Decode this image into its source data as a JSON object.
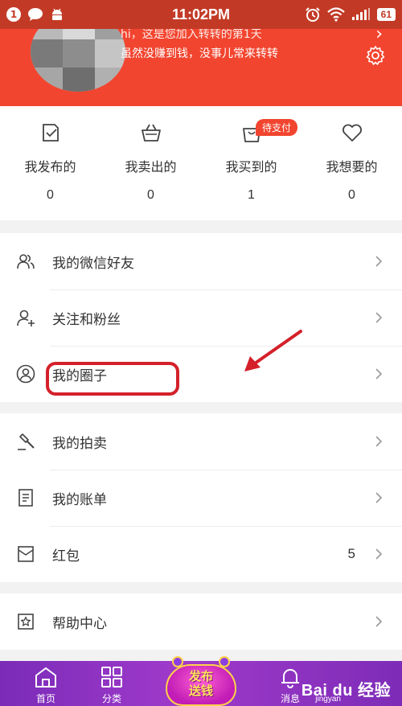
{
  "status_bar": {
    "notification_count": "1",
    "time": "11:02PM",
    "battery": "61"
  },
  "profile": {
    "message_line1": "hi，这是您加入转转的第1天",
    "message_line2": "虽然没赚到钱，没事儿常来转转"
  },
  "orders": [
    {
      "label": "我发布的",
      "count": "0",
      "icon": "check-box-icon"
    },
    {
      "label": "我卖出的",
      "count": "0",
      "icon": "basket-icon"
    },
    {
      "label": "我买到的",
      "count": "1",
      "icon": "bag-icon",
      "badge": "待支付"
    },
    {
      "label": "我想要的",
      "count": "0",
      "icon": "heart-icon"
    }
  ],
  "menu_group1": [
    {
      "label": "我的微信好友",
      "icon": "friends-icon"
    },
    {
      "label": "关注和粉丝",
      "icon": "user-plus-icon"
    },
    {
      "label": "我的圈子",
      "icon": "circle-user-icon"
    }
  ],
  "menu_group2": [
    {
      "label": "我的拍卖",
      "icon": "gavel-icon"
    },
    {
      "label": "我的账单",
      "icon": "bill-icon"
    },
    {
      "label": "红包",
      "icon": "red-envelope-icon",
      "value": "5"
    }
  ],
  "menu_group3": [
    {
      "label": "帮助中心",
      "icon": "star-box-icon"
    }
  ],
  "bottom_nav": {
    "items": [
      {
        "label": "首页",
        "icon": "home-icon"
      },
      {
        "label": "分类",
        "icon": "grid-icon"
      },
      {
        "label": "消息",
        "icon": "bell-icon"
      }
    ],
    "promo_line1": "发布",
    "promo_line2": "送钱"
  },
  "watermark": {
    "brand": "Bai du 经验",
    "sub": "jingyan"
  },
  "colors": {
    "header_red": "#f2452f",
    "status_bar_red": "#c23a26",
    "annotation_red": "#d4202a",
    "nav_purple": "#8a33c0"
  }
}
